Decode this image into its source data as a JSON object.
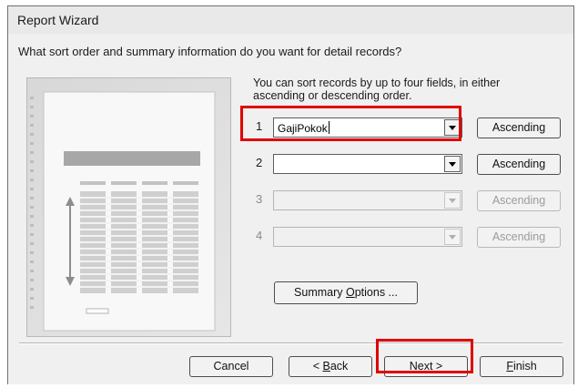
{
  "window": {
    "title": "Report Wizard"
  },
  "question": "What sort order and summary information do you want for detail records?",
  "instructions": "You can sort records by up to four fields, in either ascending or descending order.",
  "sort_fields": [
    {
      "number": "1",
      "value": "GajiPokok",
      "order_label": "Ascending",
      "enabled": true
    },
    {
      "number": "2",
      "value": "",
      "order_label": "Ascending",
      "enabled": true
    },
    {
      "number": "3",
      "value": "",
      "order_label": "Ascending",
      "enabled": false
    },
    {
      "number": "4",
      "value": "",
      "order_label": "Ascending",
      "enabled": false
    }
  ],
  "summary_button": {
    "label_prefix": "Summary ",
    "label_accel": "O",
    "label_suffix": "ptions ..."
  },
  "footer": {
    "cancel_label": "Cancel",
    "back_label_prefix": "< ",
    "back_accel": "B",
    "back_label_suffix": "ack",
    "next_accel": "N",
    "next_label_suffix": "ext >",
    "finish_accel": "F",
    "finish_label_suffix": "inish"
  },
  "highlight_color": "#e00000"
}
